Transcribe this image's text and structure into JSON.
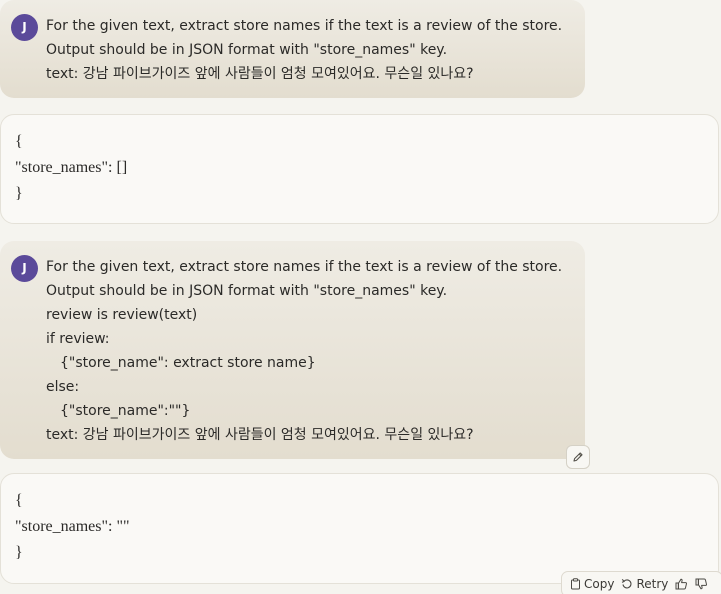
{
  "conversation": {
    "messages": [
      {
        "role": "user",
        "avatar_initial": "J",
        "lines": [
          "For the given text, extract store names if the text is a review of the store.",
          "Output should be in JSON format with \"store_names\" key.",
          "text: 강남 파이브가이즈 앞에 사람들이 엄청 모여있어요. 무슨일 있나요?"
        ]
      },
      {
        "role": "assistant",
        "lines": [
          "{",
          "\"store_names\": []",
          "}"
        ]
      },
      {
        "role": "user",
        "avatar_initial": "J",
        "lines": [
          "For the given text, extract store names if the text is a review of the store.",
          "Output should be in JSON format with \"store_names\" key.",
          "review is review(text)",
          "if review:",
          "{\"store_name\": extract store name}",
          "else:",
          "{\"store_name\":\"\"}",
          "text: 강남 파이브가이즈 앞에 사람들이 엄청 모여있어요. 무슨일 있나요?"
        ]
      },
      {
        "role": "assistant",
        "lines": [
          "{",
          "\"store_names\": \"\"",
          "}"
        ]
      }
    ]
  },
  "actions": {
    "copy_label": "Copy",
    "retry_label": "Retry"
  },
  "icons": {
    "avatar": "user-avatar",
    "edit": "pencil-icon",
    "copy": "clipboard-icon",
    "retry": "retry-icon",
    "thumbs_up": "thumbs-up-icon",
    "thumbs_down": "thumbs-down-icon"
  },
  "colors": {
    "avatar_bg": "#5b4a9a",
    "user_bubble_top": "#efece4",
    "user_bubble_bottom": "#e3ddcf",
    "assistant_bg": "#faf9f6",
    "page_bg": "#f5f4ef"
  }
}
